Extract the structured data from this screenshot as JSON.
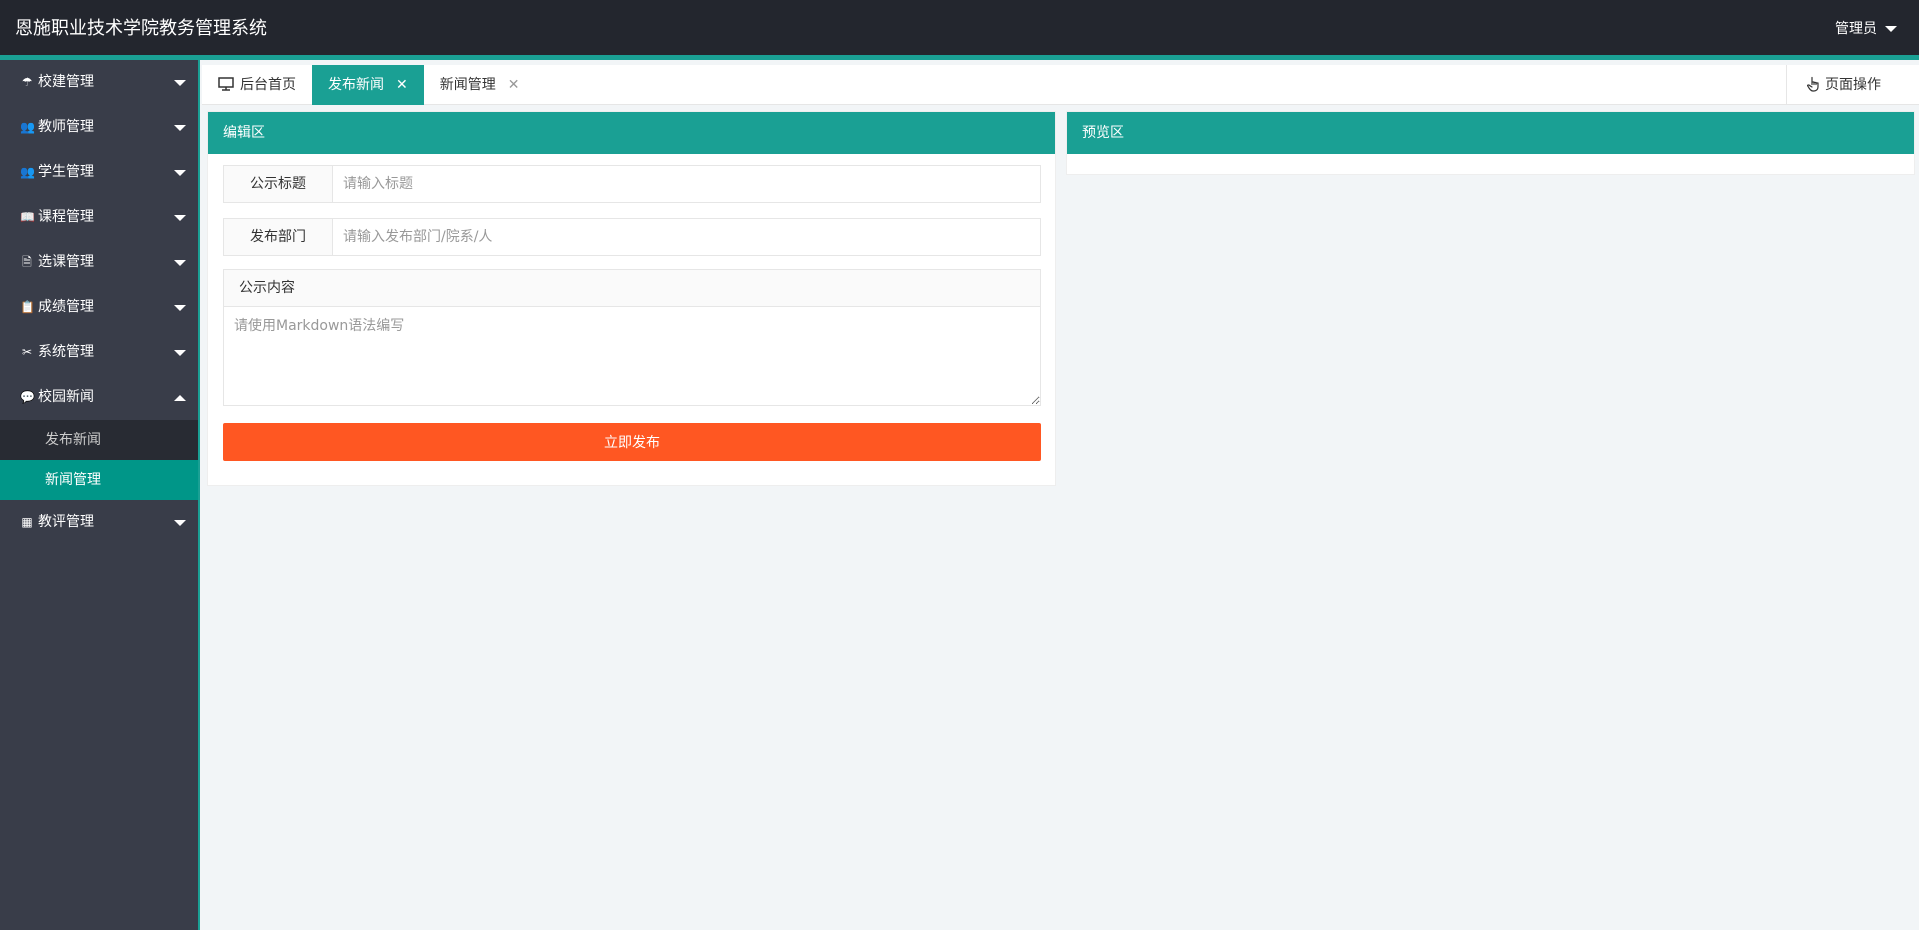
{
  "header": {
    "title": "恩施职业技术学院教务管理系统",
    "user": "管理员"
  },
  "sidebar": {
    "items": [
      {
        "label": "校建管理",
        "icon": "umbrella-icon",
        "glyph": "☂"
      },
      {
        "label": "教师管理",
        "icon": "users-icon",
        "glyph": "👥"
      },
      {
        "label": "学生管理",
        "icon": "users-icon",
        "glyph": "👥"
      },
      {
        "label": "课程管理",
        "icon": "book-icon",
        "glyph": "📖"
      },
      {
        "label": "选课管理",
        "icon": "document-icon",
        "glyph": "🗎"
      },
      {
        "label": "成绩管理",
        "icon": "clipboard-icon",
        "glyph": "📋"
      },
      {
        "label": "系统管理",
        "icon": "tools-icon",
        "glyph": "✂"
      },
      {
        "label": "校园新闻",
        "icon": "chat-icon",
        "glyph": "💬",
        "expanded": true
      },
      {
        "label": "教评管理",
        "icon": "table-icon",
        "glyph": "▦"
      }
    ],
    "news_sub": [
      {
        "label": "发布新闻"
      },
      {
        "label": "新闻管理",
        "active": true
      }
    ]
  },
  "tabs": [
    {
      "label": "后台首页",
      "icon": "monitor-icon"
    },
    {
      "label": "发布新闻",
      "active": true,
      "closable": true
    },
    {
      "label": "新闻管理",
      "closable": true
    }
  ],
  "page_op": {
    "label": "页面操作",
    "icon": "hand-pointer-icon"
  },
  "editor": {
    "title": "编辑区",
    "title_label": "公示标题",
    "title_placeholder": "请输入标题",
    "dept_label": "发布部门",
    "dept_placeholder": "请输入发布部门/院系/人",
    "content_label": "公示内容",
    "content_placeholder": "请使用Markdown语法编写",
    "submit": "立即发布"
  },
  "preview": {
    "title": "预览区"
  },
  "colors": {
    "accent": "#1aa094",
    "header_bg": "#23262e",
    "sidebar_bg": "#393d49",
    "submit": "#ff5722"
  }
}
